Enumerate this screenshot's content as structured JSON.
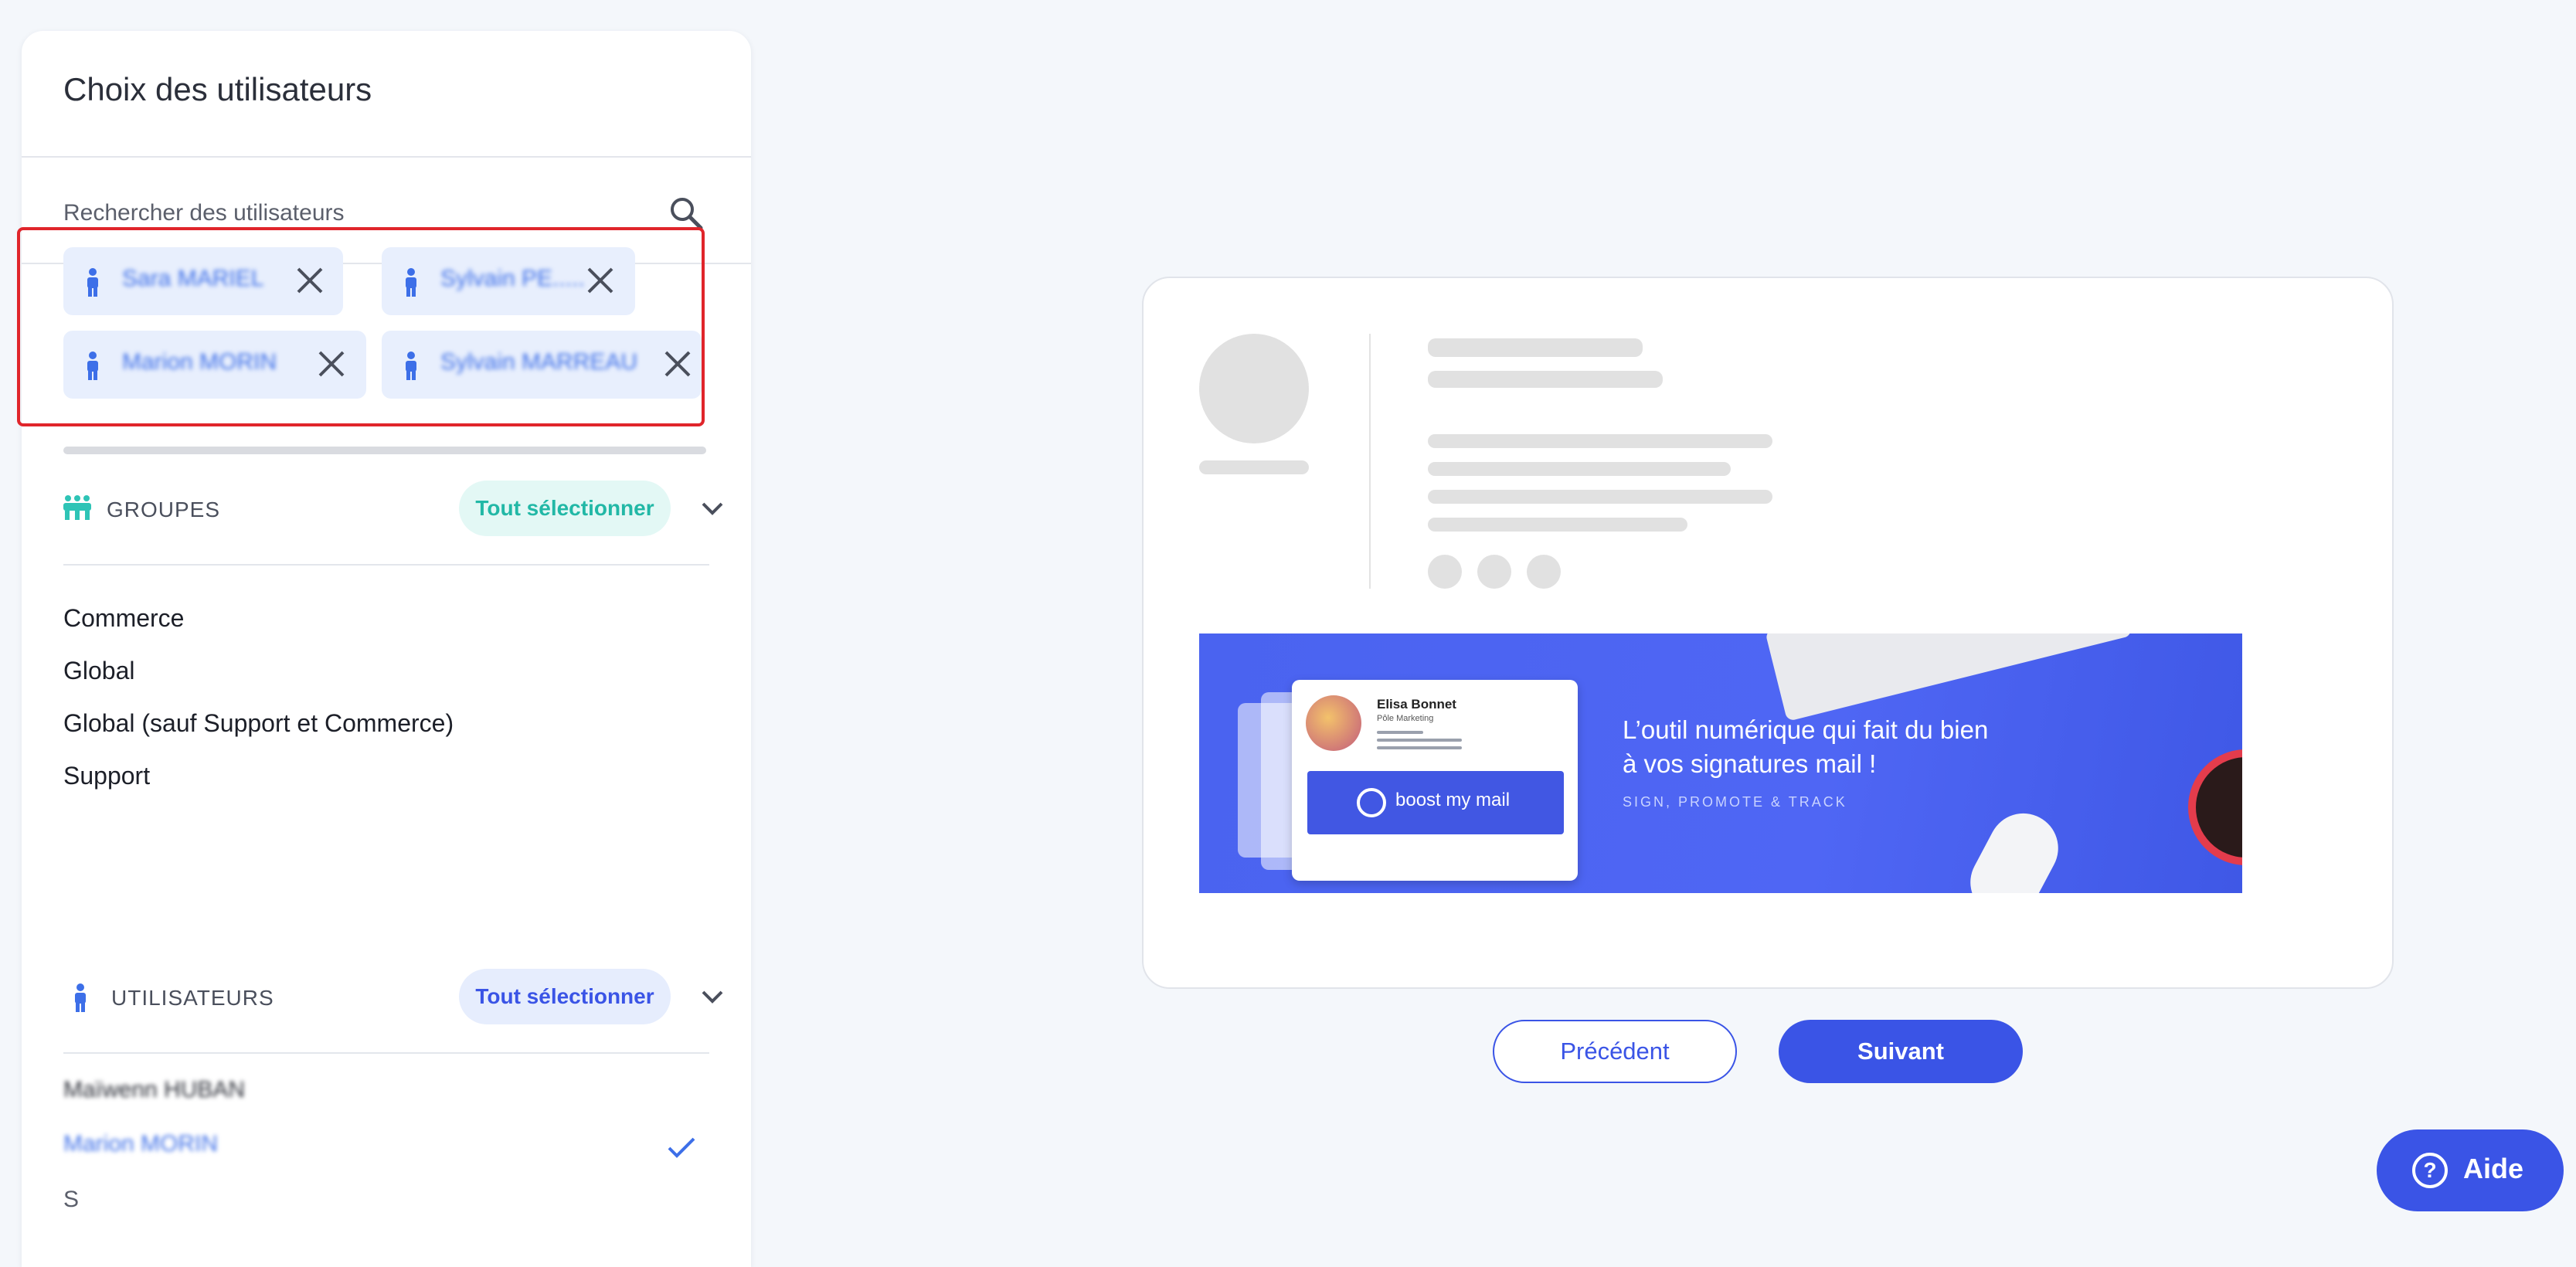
{
  "panel": {
    "title": "Choix des utilisateurs",
    "search_placeholder": "Rechercher des utilisateurs",
    "selected_chips": [
      {
        "label": "Sara MARIEL"
      },
      {
        "label": "Sylvain PE....."
      },
      {
        "label": "Marion MORIN"
      },
      {
        "label": "Sylvain MARREAU"
      }
    ],
    "groups": {
      "label": "GROUPES",
      "select_all": "Tout sélectionner",
      "items": [
        "Commerce",
        "Global",
        "Global (sauf Support et Commerce)",
        "Support"
      ]
    },
    "users": {
      "label": "UTILISATEURS",
      "select_all": "Tout sélectionner",
      "items": [
        {
          "name": "Maïwenn HUBAN",
          "selected": false
        },
        {
          "name": "Marion MORIN",
          "selected": true
        }
      ],
      "letter_heading": "S"
    }
  },
  "preview": {
    "signature": {
      "name": "Elisa Bonnet",
      "role": "Pôle Marketing",
      "button_text": "boost my mail"
    },
    "banner": {
      "line1": "L’outil numérique qui fait du bien",
      "line2": "à vos signatures mail !",
      "tagline": "SIGN, PROMOTE & TRACK"
    }
  },
  "nav": {
    "previous": "Précédent",
    "next": "Suivant"
  },
  "help": {
    "label": "Aide"
  },
  "colors": {
    "accent": "#3a54e6",
    "teal": "#2ec4b6",
    "chip_bg": "#e8effd",
    "highlight_border": "#e0252b"
  },
  "icons": [
    "search-icon",
    "person-icon",
    "close-icon",
    "group-icon",
    "chevron-down-icon",
    "check-icon",
    "question-icon"
  ]
}
